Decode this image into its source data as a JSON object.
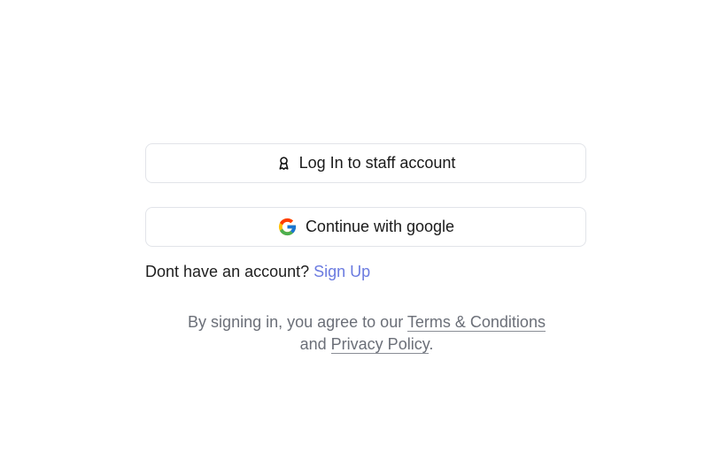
{
  "auth": {
    "staff_button_label": "Log In to staff account",
    "google_button_label": "Continue with google"
  },
  "signup": {
    "prompt": "Dont have an account?",
    "link_label": "Sign Up"
  },
  "legal": {
    "prefix": "By signing in, you agree to our",
    "terms_label": "Terms & Conditions",
    "conjunction": "and",
    "privacy_label": "Privacy Policy",
    "suffix": "."
  },
  "icons": {
    "staff": "user-badge-icon",
    "google": "google-logo-icon"
  },
  "colors": {
    "link": "#6b7be0",
    "muted_text": "#6b6f78",
    "border": "#e2e4e9"
  }
}
